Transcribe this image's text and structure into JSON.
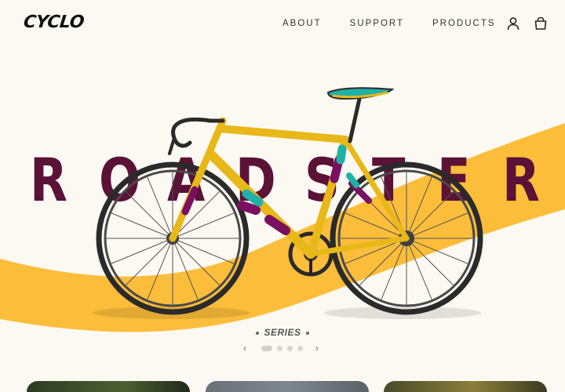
{
  "brand": {
    "logo_text": "CYCLO"
  },
  "nav": {
    "items": [
      {
        "label": "ABOUT"
      },
      {
        "label": "SUPPORT"
      },
      {
        "label": "PRODUCTS"
      }
    ]
  },
  "icons": {
    "account": "user-icon",
    "cart": "shopping-bag-icon"
  },
  "hero": {
    "model_name": "ROADSTER",
    "letters": [
      "R",
      "O",
      "A",
      "D",
      "S",
      "T",
      "E",
      "R"
    ],
    "series_label": "SERIES",
    "carousel": {
      "slide_count": 4,
      "active_index": 0
    }
  },
  "colors": {
    "background": "#fcf9f2",
    "accent_yellow": "#fbbd3a",
    "wordmark_maroon": "#5a1236",
    "frame_yellow": "#e8b818",
    "frame_purple": "#7a1060",
    "frame_teal": "#1fb0a8"
  },
  "cards": {
    "count": 3
  }
}
